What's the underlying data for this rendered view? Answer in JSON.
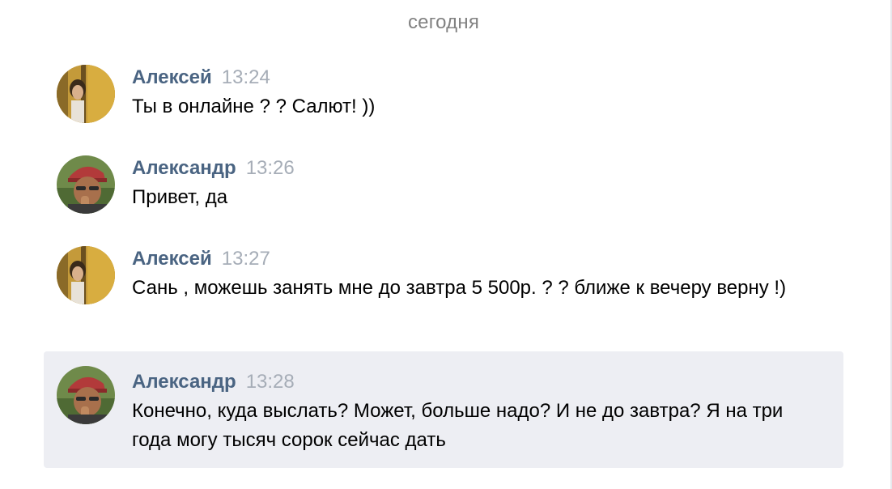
{
  "date_separator": "сегодня",
  "colors": {
    "author": "#4a6482",
    "time": "#a6adb7",
    "date": "#828282",
    "highlight_bg": "#edeef3"
  },
  "messages": [
    {
      "author": "Алексей",
      "time": "13:24",
      "text": "Ты в онлайне ? ? Салют! ))",
      "avatar": "user-avatar-aleksey-icon"
    },
    {
      "author": "Александр",
      "time": "13:26",
      "text": "Привет, да",
      "avatar": "user-avatar-aleksandr-icon"
    },
    {
      "author": "Алексей",
      "time": "13:27",
      "text": "Сань , можешь занять мне до завтра 5 500р. ? ? ближе к вечеру верну !)",
      "avatar": "user-avatar-aleksey-icon"
    },
    {
      "author": "Александр",
      "time": "13:28",
      "text": "Конечно, куда выслать? Может, больше надо? И не до завтра? Я на три года могу тысяч сорок сейчас дать",
      "avatar": "user-avatar-aleksandr-icon",
      "highlighted": true
    }
  ]
}
